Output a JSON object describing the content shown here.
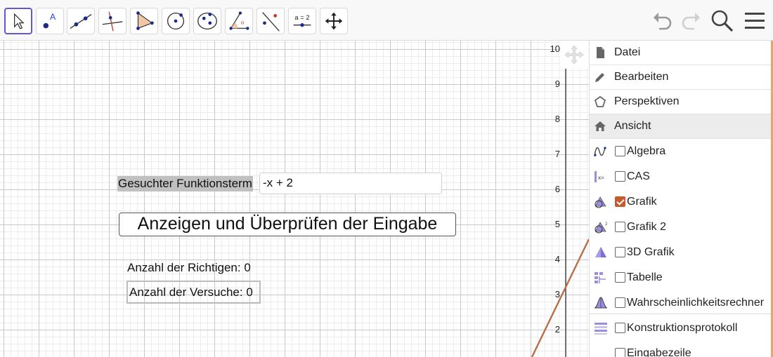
{
  "toolbar": {
    "tools": [
      {
        "icon": "move-pointer-icon",
        "active": true
      },
      {
        "icon": "point-icon"
      },
      {
        "icon": "line-icon"
      },
      {
        "icon": "perpendicular-line-icon"
      },
      {
        "icon": "polygon-icon"
      },
      {
        "icon": "circle-center-point-icon"
      },
      {
        "icon": "ellipse-icon"
      },
      {
        "icon": "angle-icon"
      },
      {
        "icon": "reflect-icon"
      },
      {
        "icon": "slider-icon",
        "text": "a = 2"
      },
      {
        "icon": "move-graphics-view-icon"
      }
    ],
    "right": [
      "undo-icon",
      "redo-icon",
      "search-icon",
      "menu-icon"
    ]
  },
  "graphics": {
    "y_ticks": [
      "10",
      "9",
      "8",
      "7",
      "6",
      "5",
      "4",
      "3",
      "2"
    ],
    "term_label": "Gesuchter Funktionsterm",
    "term_value": "-x + 2",
    "check_button": "Anzeigen und Überprüfen der Eingabe",
    "correct_count": "Anzahl der Richtigen: 0",
    "attempts_count": "Anzahl der Versuche: 0",
    "line_color": "#b5704a"
  },
  "menu": {
    "items": [
      {
        "label": "Datei",
        "icon": "file-icon"
      },
      {
        "label": "Bearbeiten",
        "icon": "pencil-icon"
      },
      {
        "label": "Perspektiven",
        "icon": "pentagon-icon"
      },
      {
        "label": "Ansicht",
        "icon": "home-icon",
        "active": true
      }
    ],
    "views": [
      {
        "label": "Algebra",
        "icon": "algebra-view-icon",
        "checked": false
      },
      {
        "label": "CAS",
        "icon": "cas-view-icon",
        "checked": false
      },
      {
        "label": "Grafik",
        "icon": "graphics-view-icon",
        "checked": true
      },
      {
        "label": "Grafik 2",
        "icon": "graphics2-view-icon",
        "checked": false
      },
      {
        "label": "3D Grafik",
        "icon": "3d-graphics-view-icon",
        "checked": false
      },
      {
        "label": "Tabelle",
        "icon": "spreadsheet-view-icon",
        "checked": false
      },
      {
        "label": "Wahrscheinlichkeitsrechner",
        "icon": "probability-view-icon",
        "checked": false
      },
      {
        "label": "Konstruktionsprotokoll",
        "icon": "construction-protocol-icon",
        "checked": false
      },
      {
        "label": "Eingabezeile",
        "icon": "",
        "checked": false
      }
    ],
    "accent_color": "#c85b2c"
  }
}
